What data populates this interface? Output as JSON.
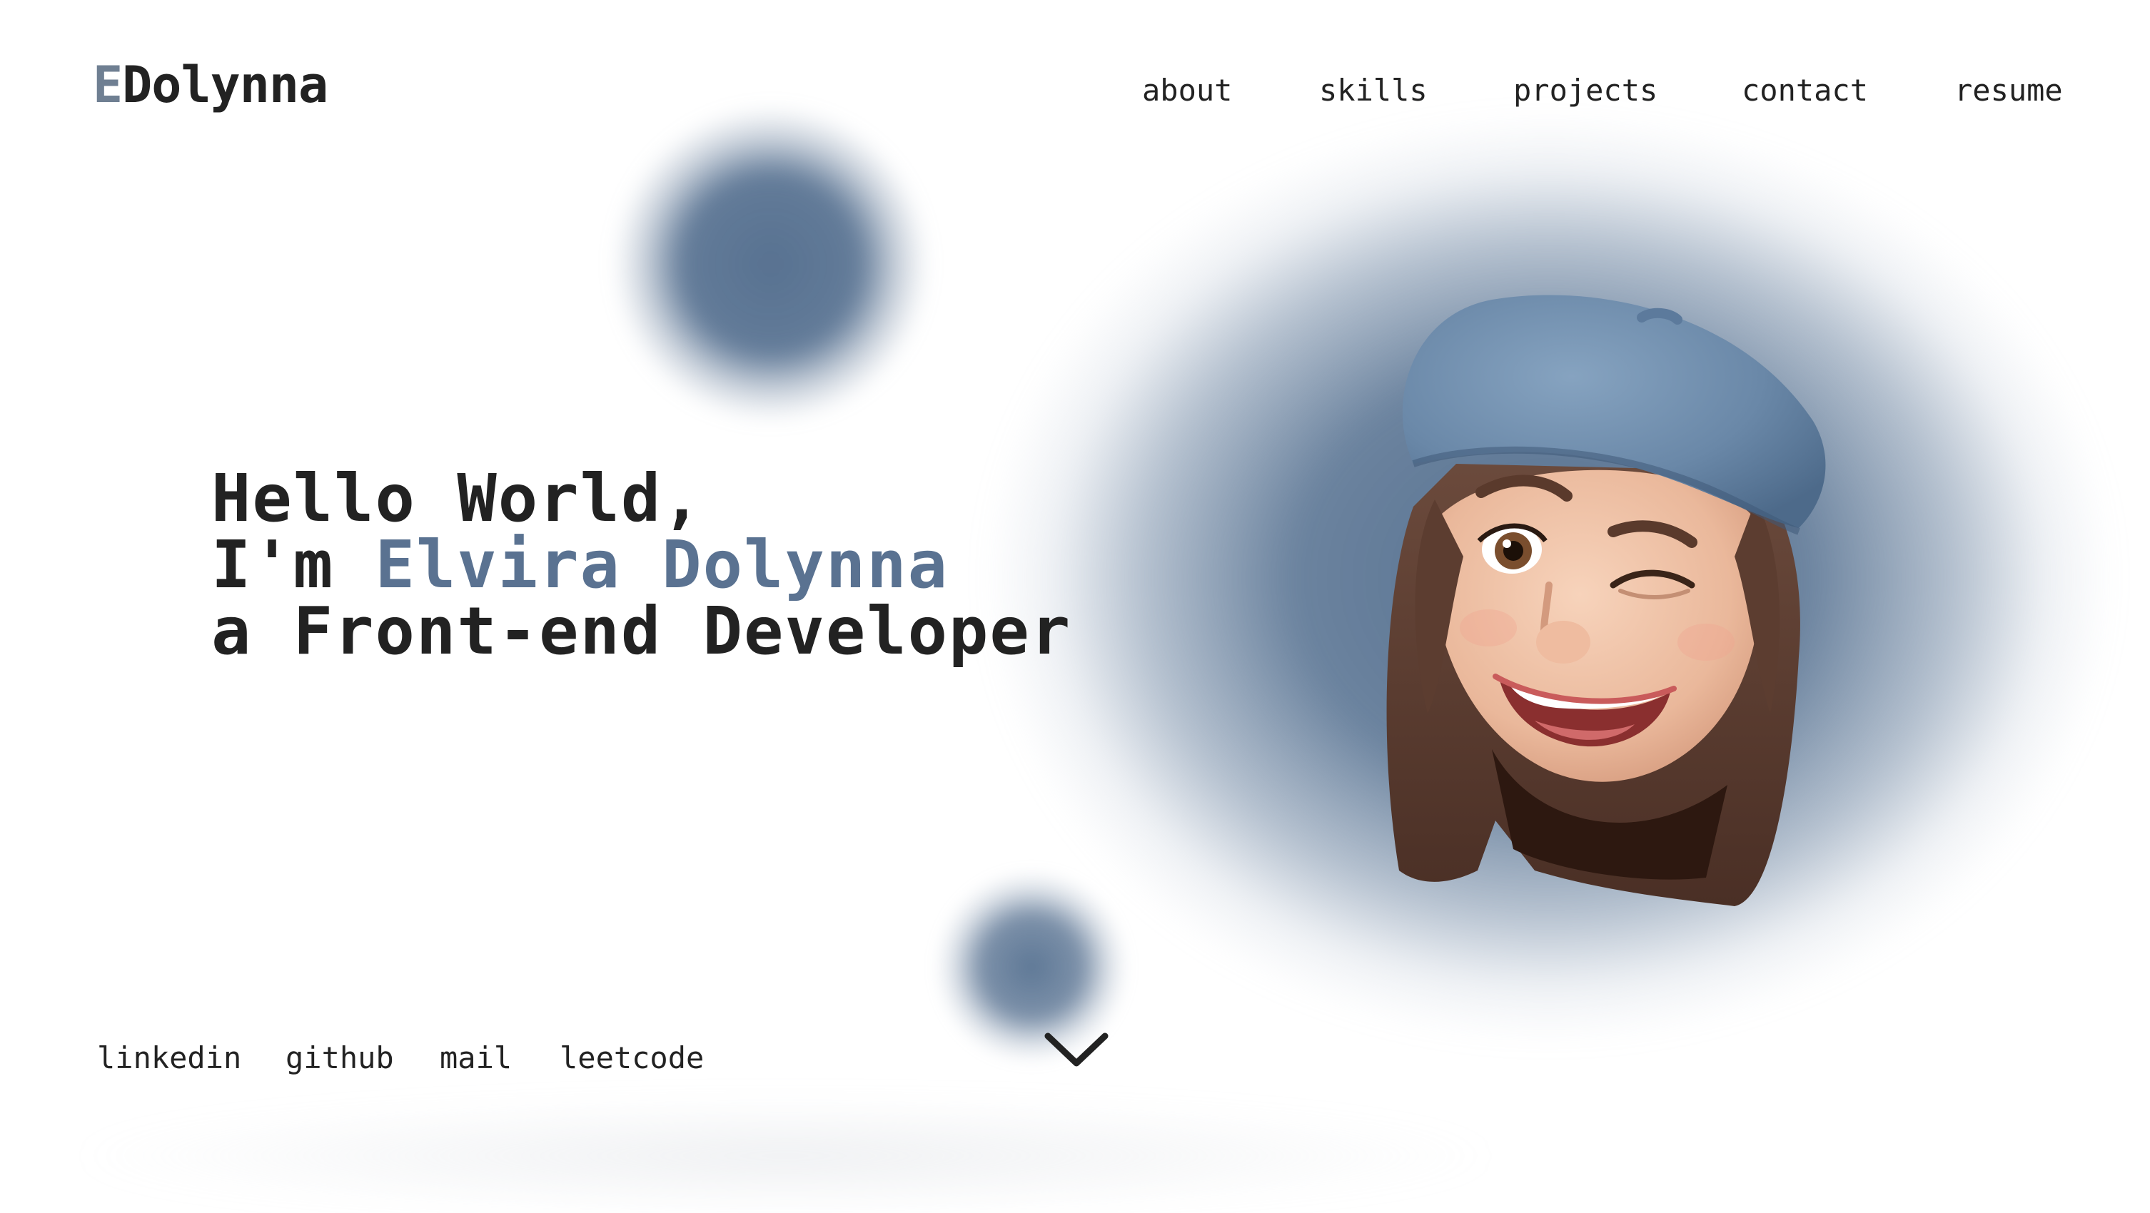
{
  "logo": {
    "initial": "E",
    "name": "Dolynna"
  },
  "nav": {
    "items": [
      {
        "label": "about"
      },
      {
        "label": "skills"
      },
      {
        "label": "projects"
      },
      {
        "label": "contact"
      },
      {
        "label": "resume"
      }
    ]
  },
  "hero": {
    "line1": "Hello World,",
    "line2_prefix": "I'm ",
    "line2_name": "Elvira Dolynna",
    "line3": "a Front-end Developer"
  },
  "socials": {
    "items": [
      {
        "label": "linkedin"
      },
      {
        "label": "github"
      },
      {
        "label": "mail"
      },
      {
        "label": "leetcode"
      }
    ]
  },
  "icons": {
    "scroll_down": "chevron-down-icon",
    "avatar": "memoji-avatar"
  },
  "colors": {
    "accent": "#5a7291",
    "text": "#222222",
    "logo_initial": "#6f7f92",
    "background": "#ffffff"
  }
}
